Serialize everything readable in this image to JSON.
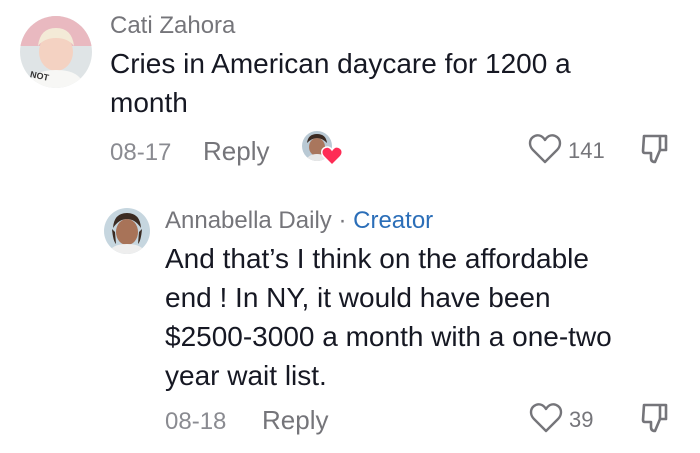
{
  "comment": {
    "author": "Cati Zahora",
    "text_line1": "Cries in American daycare for 1200 a",
    "text_line2": "month",
    "date": "08-17",
    "reply_label": "Reply",
    "like_count": "141",
    "avatar_shirt_text": "NOT"
  },
  "reply": {
    "author": "Annabella Daily",
    "separator": "·",
    "badge": "Creator",
    "text_line1": "And that’s I think on the affordable",
    "text_line2": "end ! In NY, it would have been",
    "text_line3": "$2500-3000 a month with a one-two",
    "text_line4": "year wait list.",
    "date": "08-18",
    "reply_label": "Reply",
    "like_count": "39"
  },
  "icons": {
    "like": "heart-outline-icon",
    "dislike": "thumbs-down-icon",
    "creator_liked": "creator-liked-heart-icon"
  },
  "colors": {
    "creator_badge": "#2b6eb8",
    "liked_heart": "#fe2c55",
    "secondary_text": "#75757a"
  }
}
